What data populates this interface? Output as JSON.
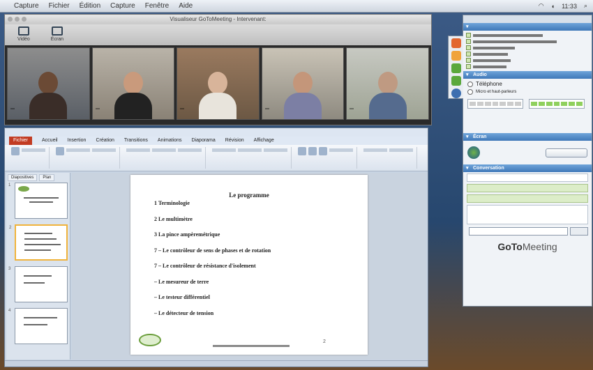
{
  "menubar": {
    "app": "Capture",
    "items": [
      "Capture",
      "Fichier",
      "Édition",
      "Capture",
      "Fenêtre",
      "Aide"
    ],
    "clock": "11:33"
  },
  "viewer": {
    "title": "Visualiseur GoToMeeting - Intervenant: ",
    "toolbar": [
      "Vidéo",
      "Écran"
    ],
    "participants": [
      "",
      "",
      "",
      "",
      ""
    ]
  },
  "ppt": {
    "file_tab": "Fichier",
    "tabs": [
      "Accueil",
      "Insertion",
      "Création",
      "Transitions",
      "Animations",
      "Diaporama",
      "Révision",
      "Affichage"
    ],
    "thumb_tabs": [
      "Diapositives",
      "Plan"
    ],
    "slide": {
      "title": "Le programme",
      "items": [
        "1 Terminologie",
        "2 Le multimètre",
        "3 La pince ampèremétrique",
        "7 – Le contrôleur de sens de phases et de rotation",
        "7 – Le contrôleur de résistance d'isolement",
        "– Le mesureur de terre",
        "– Le testeur différentiel",
        "– Le détecteur de tension"
      ],
      "page": "2"
    }
  },
  "panel": {
    "header": "",
    "participants_bar": "",
    "audio_bar": "Audio",
    "audio_phone": "Téléphone",
    "audio_mic": "Micro et haut-parleurs",
    "screen_bar": "Écran",
    "screen_btn": "",
    "chat_bar": "Conversation",
    "chat_messages": [
      "",
      ""
    ],
    "chat_input_placeholder": "",
    "send_label": "",
    "brand_goto": "GoTo",
    "brand_meeting": "Meeting"
  }
}
